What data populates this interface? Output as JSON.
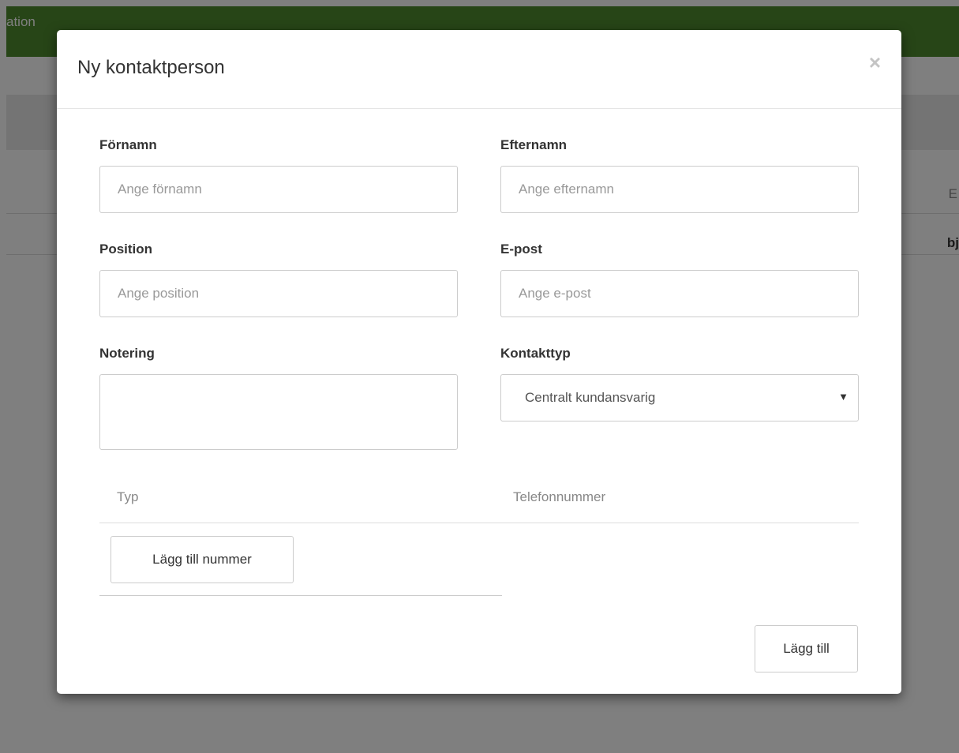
{
  "background": {
    "navbar_text": "ation",
    "column_header": "E",
    "column_cell": "bj"
  },
  "modal": {
    "title": "Ny kontaktperson",
    "close_symbol": "×",
    "fields": {
      "first_name": {
        "label": "Förnamn",
        "placeholder": "Ange förnamn",
        "value": ""
      },
      "last_name": {
        "label": "Efternamn",
        "placeholder": "Ange efternamn",
        "value": ""
      },
      "position": {
        "label": "Position",
        "placeholder": "Ange position",
        "value": ""
      },
      "email": {
        "label": "E-post",
        "placeholder": "Ange e-post",
        "value": ""
      },
      "note": {
        "label": "Notering",
        "value": ""
      },
      "contact_type": {
        "label": "Kontakttyp",
        "selected": "Centralt kundansvarig"
      }
    },
    "phone_table": {
      "columns": [
        "Typ",
        "Telefonnummer"
      ]
    },
    "add_number_button": "Lägg till nummer",
    "submit_button": "Lägg till"
  },
  "colors": {
    "navbar": "#4f8a2f",
    "backdrop": "rgba(0,0,0,0.5)"
  }
}
